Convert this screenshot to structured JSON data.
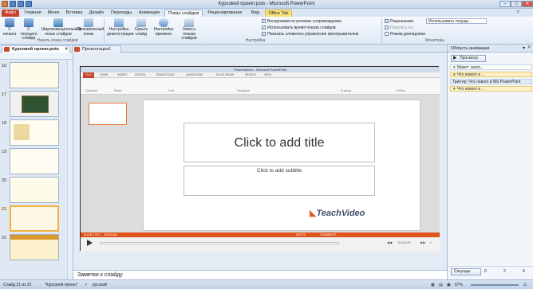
{
  "window": {
    "title": "Курсовой проект.potx - Microsoft PowerPoint",
    "controls": [
      "–",
      "□",
      "✕"
    ]
  },
  "ribbon_tabs": [
    "Файл",
    "Главная",
    "Меню",
    "Вставка",
    "Дизайн",
    "Переходы",
    "Анимация",
    "Показ слайдов",
    "Рецензирование",
    "Вид",
    "Office Tab"
  ],
  "ribbon": {
    "start_group": {
      "from_start": "С начала",
      "from_current": "С текущего слайда",
      "broadcast": "Широковещательный показ слайдов",
      "custom": "Произвольный показ",
      "label": "Начать показ слайдов"
    },
    "setup_group": {
      "setup": "Настройка демонстрации",
      "hide": "Скрыть слайд",
      "rehearse": "Настройка времени",
      "record": "Запись показа слайдов"
    },
    "checks": [
      "Воспроизвести речевое сопровождение",
      "Использовать время показа слайдов",
      "Показать элементы управления проигрывателем"
    ],
    "setup_label": "Настройка",
    "resolution_label": "Разрешение:",
    "resolution_value": "Использовать текуще...",
    "show_on": "Показать на:",
    "presenter": "Режим докладчика",
    "monitors_label": "Мониторы"
  },
  "doc_tabs": [
    "Курсовой проект.potx",
    "Презентация1"
  ],
  "thumbs": {
    "numbers": [
      "16",
      "17",
      "18",
      "19",
      "20",
      "21",
      "22"
    ],
    "selected": "21"
  },
  "video": {
    "title": "Presentation1 - Microsoft PowerPoint",
    "file_tab": "FILE",
    "tabs": [
      "HOME",
      "INSERT",
      "DESIGN",
      "TRANSITIONS",
      "ANIMATIONS",
      "SLIDE SHOW",
      "REVIEW",
      "VIEW"
    ],
    "groups": [
      "Clipboard",
      "Slides",
      "Font",
      "Paragraph",
      "Drawing",
      "Editing"
    ],
    "slide_title": "Click to add title",
    "slide_subtitle": "Click to add subtitle",
    "bar_left": "SLIDE 1 OF 1",
    "bar_lang": "RUSSIAN",
    "bar_notes": "NOTES",
    "bar_comments": "COMMENTS",
    "time": "00:00.00",
    "logo": "TeachVideo"
  },
  "notes": "Заметки к слайду",
  "anim_pane": {
    "title": "Область анимации",
    "preview": "Просмотр",
    "trigger1": "Макет: загол...",
    "trigger_hdr": "Триггер: Что нового в MS PowerPoint",
    "trigger2": "Что нового в ...",
    "trigger3": "Что нового в ...",
    "seconds": "Секунды",
    "scale": [
      "0",
      "2",
      "4"
    ]
  },
  "status": {
    "slide": "Слайд 21 из 22",
    "theme": "\"Курсовой проект\"",
    "lang": "русский",
    "zoom": "87%"
  }
}
